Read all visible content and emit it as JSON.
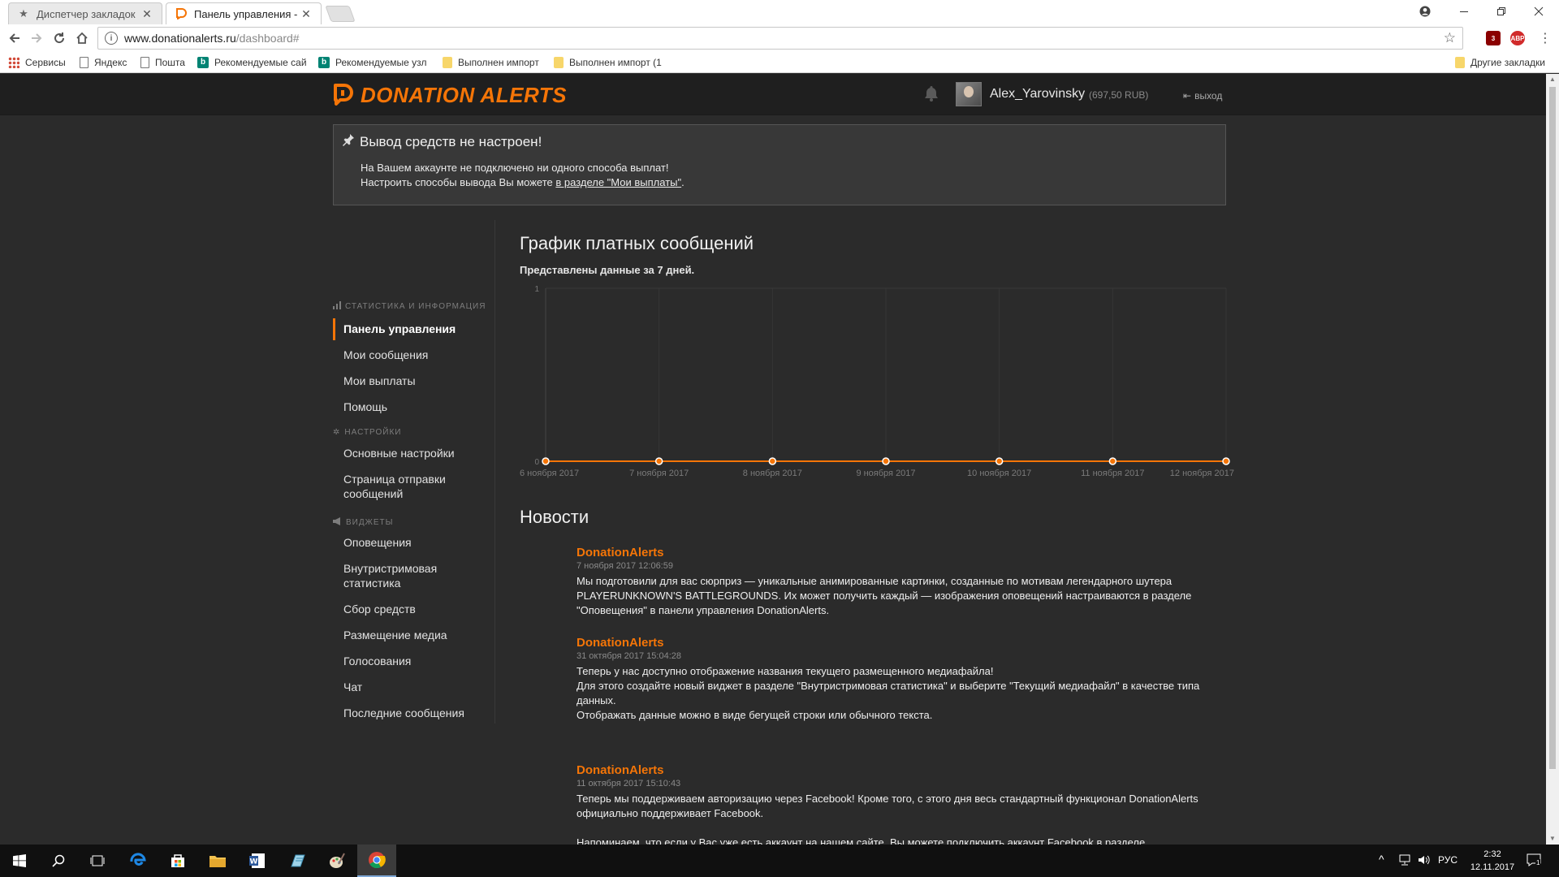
{
  "browser": {
    "tabs": [
      {
        "label": "Диспетчер закладок",
        "active": false,
        "icon": "star-icon"
      },
      {
        "label": "Панель управления - Do",
        "active": true,
        "icon": "donationalerts-favicon"
      }
    ],
    "close_glyph": "✕",
    "address": {
      "host": "www.donationalerts.ru",
      "path": "/dashboard#"
    },
    "bookmarks": [
      {
        "label": "Сервисы",
        "icon": "apps-grid-icon"
      },
      {
        "label": "Яндекс",
        "icon": "page-icon"
      },
      {
        "label": "Пошта",
        "icon": "page-icon"
      },
      {
        "label": "Рекомендуемые сай",
        "icon": "bing-icon"
      },
      {
        "label": "Рекомендуемые узл",
        "icon": "bing-icon"
      },
      {
        "label": "Выполнен импорт",
        "icon": "folder-icon"
      },
      {
        "label": "Выполнен импорт (1",
        "icon": "folder-icon"
      }
    ],
    "other_bookmarks": "Другие закладки",
    "extensions": [
      {
        "name": "ublock-icon",
        "text": "3",
        "color": "#8b0000"
      },
      {
        "name": "adblock-icon",
        "text": "ABP",
        "color": "#d12b2b"
      }
    ]
  },
  "site": {
    "logo_text": "DONATION ALERTS",
    "brand_color": "#f57507",
    "user": {
      "name": "Alex_Yarovinsky",
      "balance": "(697,50 RUB)"
    },
    "logout_label": "выход"
  },
  "alert": {
    "title": "Вывод средств не настроен!",
    "line1": "На Вашем аккаунте не подключено ни одного способа выплат!",
    "line2_prefix": "Настроить способы вывода Вы можете ",
    "line2_link": "в разделе \"Мои выплаты\"",
    "line2_suffix": "."
  },
  "sidebar": {
    "sections": [
      {
        "title": "СТАТИСТИКА И ИНФОРМАЦИЯ",
        "icon": "bar-chart-icon",
        "items": [
          "Панель управления",
          "Мои сообщения",
          "Мои выплаты",
          "Помощь"
        ]
      },
      {
        "title": "НАСТРОЙКИ",
        "icon": "gear-icon",
        "items": [
          "Основные настройки",
          "Страница отправки сообщений"
        ]
      },
      {
        "title": "ВИДЖЕТЫ",
        "icon": "megaphone-icon",
        "items": [
          "Оповещения",
          "Внутристримовая статистика",
          "Сбор средств",
          "Размещение медиа",
          "Голосования",
          "Чат",
          "Последние сообщения"
        ]
      }
    ],
    "active_item": "Панель управления"
  },
  "chart_section": {
    "title": "График платных сообщений",
    "subtitle": "Представлены данные за 7 дней."
  },
  "chart_data": {
    "type": "line",
    "categories": [
      "6 ноября 2017",
      "7 ноября 2017",
      "8 ноября 2017",
      "9 ноября 2017",
      "10 ноября 2017",
      "11 ноября 2017",
      "12 ноября 2017"
    ],
    "series": [
      {
        "values": [
          0,
          0,
          0,
          0,
          0,
          0,
          0
        ],
        "color": "#f57507"
      }
    ],
    "yticks": [
      "0",
      "1"
    ],
    "ylim": [
      0,
      1
    ],
    "grid": true
  },
  "news": {
    "title": "Новости",
    "items": [
      {
        "author": "DonationAlerts",
        "date": "7 ноября 2017 12:06:59",
        "paragraphs": [
          "Мы подготовили для вас сюрприз — уникальные анимированные картинки, созданные по мотивам легендарного шутера PLAYERUNKNOWN'S BATTLEGROUNDS. Их может получить каждый — изображения оповещений настраиваются в разделе \"Оповещения\" в панели управления DonationAlerts."
        ]
      },
      {
        "author": "DonationAlerts",
        "date": "31 октября 2017 15:04:28",
        "paragraphs": [
          "Теперь у нас доступно отображение названия текущего размещенного медиафайла!",
          "Для этого создайте новый виджет в разделе \"Внутристримовая статистика\" и выберите \"Текущий медиафайл\" в качестве типа данных.",
          "Отображать данные можно в виде бегущей строки или обычного текста."
        ]
      },
      {
        "author": "DonationAlerts",
        "date": "11 октября 2017 15:10:43",
        "paragraphs": [
          "Теперь мы поддерживаем авторизацию через Facebook! Кроме того, с этого дня весь стандартный функционал DonationAlerts официально поддерживает Facebook.",
          "Напоминаем, что если у Вас уже есть аккаунт на нашем сайте, Вы можете подключить аккаунт Facebook в разделе"
        ]
      }
    ]
  },
  "taskbar": {
    "apps": [
      "windows-start-icon",
      "search-icon",
      "task-view-icon",
      "edge-icon",
      "store-icon",
      "file-explorer-icon",
      "word-icon",
      "notepad-icon",
      "paint-icon",
      "chrome-icon"
    ],
    "language": "РУС",
    "time": "2:32",
    "date": "12.11.2017",
    "notification_count": "1"
  }
}
